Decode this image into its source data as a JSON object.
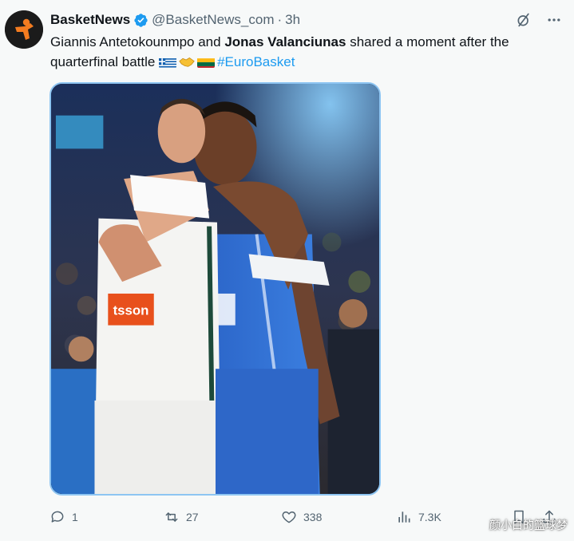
{
  "tweet": {
    "display_name": "BasketNews",
    "handle": "@BasketNews_com",
    "separator": "·",
    "time": "3h",
    "text_part1": "Giannis Antetokounmpo and ",
    "text_bold": "Jonas Valanciunas",
    "text_part2": " shared a moment after the quarterfinal battle ",
    "hashtag": "#EuroBasket",
    "image_jersey_text": "tsson"
  },
  "icons": {
    "verified": "verified-badge-icon",
    "grok": "grok-icon",
    "more": "more-icon",
    "reply": "reply-icon",
    "retweet": "retweet-icon",
    "like": "heart-icon",
    "views": "views-icon",
    "bookmark": "bookmark-icon",
    "share": "share-icon"
  },
  "stats": {
    "replies": "1",
    "retweets": "27",
    "likes": "338",
    "views": "7.3K"
  },
  "colors": {
    "accent": "#1d9bf0",
    "secondary_text": "#536471",
    "media_border": "#8ec5f2"
  },
  "watermark": "颜小白的篮球梦"
}
